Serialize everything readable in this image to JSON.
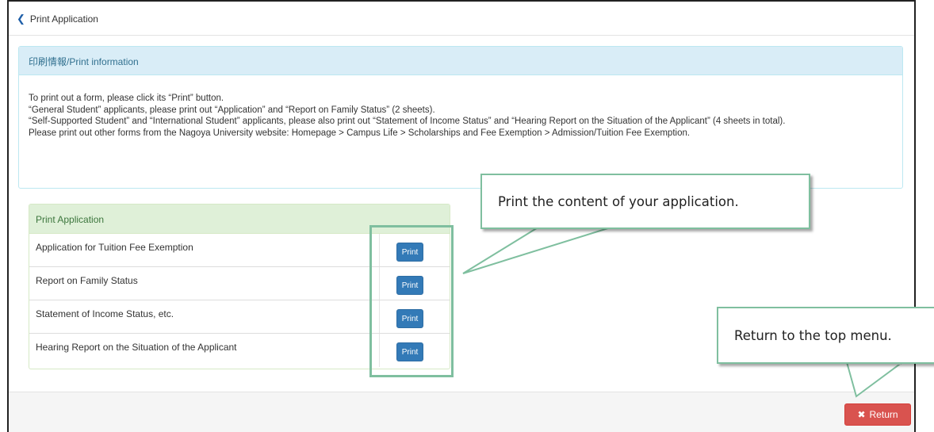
{
  "topbar": {
    "back_label": "Print Application"
  },
  "info": {
    "title": "印刷情報/Print information",
    "lines": [
      "To print out a form, please click its “Print” button.",
      "“General Student” applicants, please print out “Application” and “Report on Family Status” (2 sheets).",
      "“Self-Supported Student” and “International Student” applicants, please also print out “Statement of Income Status” and “Hearing Report on the Situation of the Applicant” (4 sheets in total).",
      "Please print out other forms from the Nagoya University website: Homepage > Campus Life > Scholarships and Fee Exemption > Admission/Tuition Fee Exemption."
    ]
  },
  "print_panel": {
    "title": "Print Application",
    "rows": [
      {
        "label": "Application for Tuition Fee Exemption",
        "button": "Print"
      },
      {
        "label": "Report on Family Status",
        "button": "Print"
      },
      {
        "label": "Statement of Income Status, etc.",
        "button": "Print"
      },
      {
        "label": "Hearing Report on the Situation of the Applicant",
        "button": "Print"
      }
    ]
  },
  "footer": {
    "return_label": "Return",
    "return_icon": "times-icon"
  },
  "annotations": {
    "print_callout": "Print the content of your application.",
    "return_callout": "Return to the top menu."
  },
  "colors": {
    "info_header_bg": "#d9edf7",
    "success_header_bg": "#dff0d8",
    "primary_button": "#337ab7",
    "danger_button": "#d9534f",
    "annotation_green": "#7fbf9f"
  }
}
